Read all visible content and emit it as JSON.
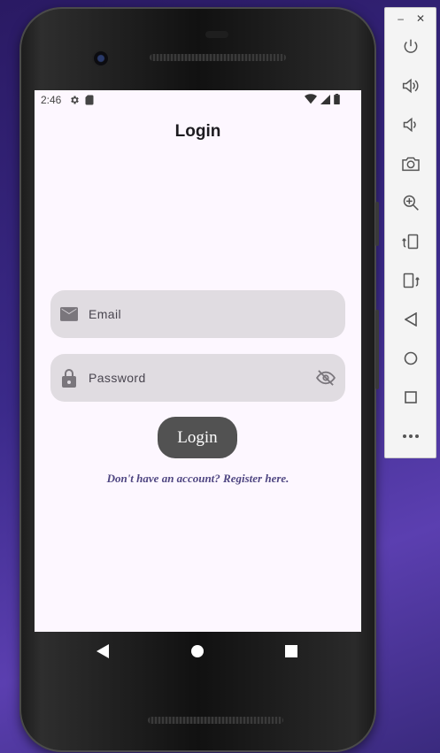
{
  "status_bar": {
    "time": "2:46",
    "left_icons": [
      "settings-icon",
      "sd-card-icon"
    ],
    "right_icons": [
      "wifi-icon",
      "signal-icon",
      "battery-icon"
    ]
  },
  "app": {
    "title": "Login",
    "email_field": {
      "placeholder": "Email",
      "icon": "email-icon"
    },
    "password_field": {
      "placeholder": "Password",
      "icon": "lock-icon",
      "toggle_icon": "visibility-off-icon"
    },
    "login_button": "Login",
    "register_link": "Don't have an account? Register here."
  },
  "nav_bar": [
    "back-icon",
    "home-icon",
    "recents-icon"
  ],
  "emulator_toolbar": {
    "window_controls": {
      "minimize": "–",
      "close": "✕"
    },
    "buttons": [
      "power-icon",
      "volume-up-icon",
      "volume-down-icon",
      "rotate-left-icon",
      "rotate-right-icon",
      "camera-icon",
      "zoom-icon",
      "back-icon",
      "home-icon",
      "overview-icon",
      "more-icon"
    ]
  },
  "colors": {
    "screen_bg": "#fdf7ff",
    "field_bg": "#e0dce1",
    "button_bg": "#525252",
    "link_color": "#4f4682"
  }
}
